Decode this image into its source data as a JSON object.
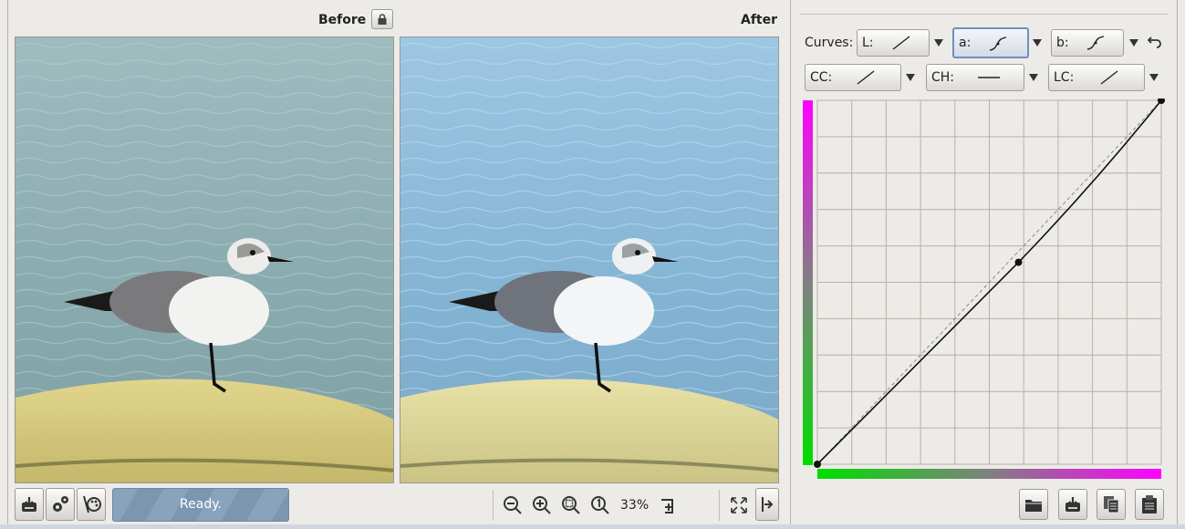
{
  "before_panel": {
    "label": "Before"
  },
  "after_panel": {
    "label": "After"
  },
  "status": {
    "text": "Ready."
  },
  "zoom": {
    "level": "33%"
  },
  "curves": {
    "label": "Curves:",
    "row1": [
      {
        "label": "L:",
        "shape": "linear"
      },
      {
        "label": "a:",
        "shape": "s-curve",
        "active": true
      },
      {
        "label": "b:",
        "shape": "s-curve"
      }
    ],
    "row2": [
      {
        "label": "CC:",
        "shape": "linear"
      },
      {
        "label": "CH:",
        "shape": "flat"
      },
      {
        "label": "LC:",
        "shape": "linear"
      }
    ]
  },
  "curve_editor": {
    "channel": "a",
    "control_points": [
      [
        0,
        0
      ],
      [
        0.58,
        0.56
      ],
      [
        1,
        1
      ]
    ],
    "gradient_colors": {
      "low": "#00dd00",
      "high": "#ff00ff"
    }
  },
  "icons": {
    "toolbar_left": [
      "save-icon",
      "settings-icon",
      "palette-icon"
    ],
    "zoom_controls": [
      "zoom-out-icon",
      "zoom-in-icon",
      "zoom-fit-icon",
      "zoom-100-icon",
      "new-detail-window-icon",
      "fullscreen-icon",
      "collapse-panel-icon"
    ],
    "curve_actions": [
      "open-icon",
      "save-icon",
      "copy-icon",
      "paste-icon"
    ]
  }
}
